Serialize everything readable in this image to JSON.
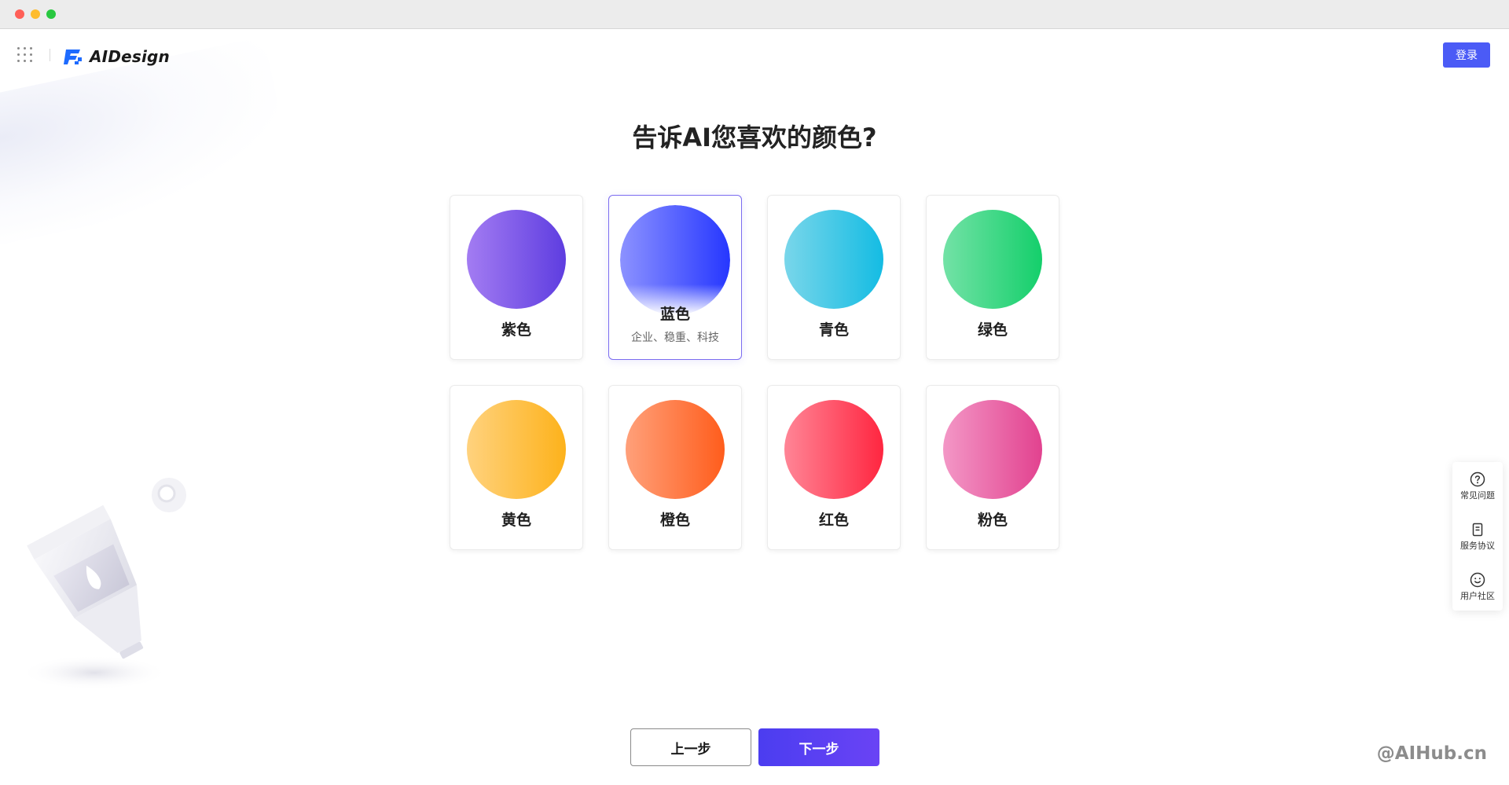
{
  "brand": {
    "name": "AIDesign",
    "accent": "#4b5bf6"
  },
  "header": {
    "login_label": "登录"
  },
  "title": "告诉AI您喜欢的颜色?",
  "colors": [
    {
      "label": "紫色",
      "gradient": [
        "#a37cf2",
        "#5e3de0"
      ],
      "selected": false
    },
    {
      "label": "蓝色",
      "desc": "企业、稳重、科技",
      "gradient": [
        "#8c92ff",
        "#2637ff"
      ],
      "selected": true
    },
    {
      "label": "青色",
      "gradient": [
        "#79d6ea",
        "#14bce3"
      ],
      "selected": false
    },
    {
      "label": "绿色",
      "gradient": [
        "#73e2a6",
        "#14cf6b"
      ],
      "selected": false
    },
    {
      "label": "黄色",
      "gradient": [
        "#ffd27e",
        "#fdb21b"
      ],
      "selected": false
    },
    {
      "label": "橙色",
      "gradient": [
        "#ffa07a",
        "#ff5d1c"
      ],
      "selected": false
    },
    {
      "label": "红色",
      "gradient": [
        "#ff8596",
        "#ff2640"
      ],
      "selected": false
    },
    {
      "label": "粉色",
      "gradient": [
        "#f397c6",
        "#e2428f"
      ],
      "selected": false
    }
  ],
  "buttons": {
    "prev": "上一步",
    "next": "下一步"
  },
  "side_panel": [
    {
      "label": "常见问题",
      "icon": "question-circle-icon"
    },
    {
      "label": "服务协议",
      "icon": "document-icon"
    },
    {
      "label": "用户社区",
      "icon": "smile-icon"
    }
  ],
  "watermark": "@AIHub.cn"
}
